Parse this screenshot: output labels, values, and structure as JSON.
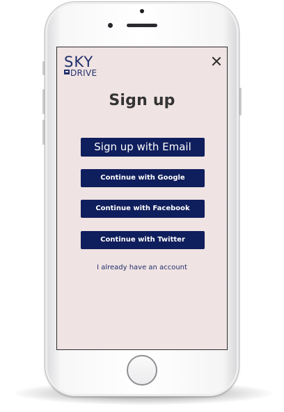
{
  "logo": {
    "line1": "SKY",
    "line2": "DRIVE"
  },
  "icons": {
    "close": "close-icon",
    "logo_mark": "sky-drive-logo-mark"
  },
  "signup": {
    "title": "Sign up",
    "email_button": "Sign up with Email",
    "google_button": "Continue with Google",
    "facebook_button": "Continue with Facebook",
    "twitter_button": "Continue with Twitter",
    "login_link": "I already have an account"
  },
  "colors": {
    "screen_background": "#f0e3e3",
    "button_background": "#0f1e5c",
    "button_text": "#ffffff",
    "brand_navy": "#1f2f6b",
    "title_text": "#333333"
  }
}
